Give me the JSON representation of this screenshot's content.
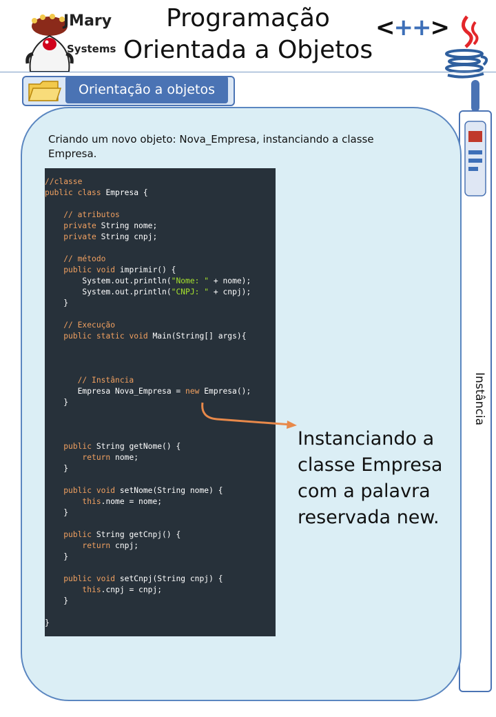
{
  "header": {
    "logo_line1": "JMary",
    "logo_line2": "Systems",
    "title_line1": "Programação",
    "title_line2": "Orientada a Objetos",
    "cpp_left": "<",
    "cpp_plus": "++",
    "cpp_right": ">"
  },
  "section": {
    "label": "Orientação a objetos"
  },
  "sidebar": {
    "label": "Instância"
  },
  "content": {
    "intro": "Criando um novo objeto: Nova_Empresa, instanciando a classe Empresa.",
    "callout": "Instanciando a classe Empresa com a palavra reservada new."
  },
  "code": [
    "//classe",
    "public class Empresa {",
    "",
    "    // atributos",
    "    private String nome;",
    "    private String cnpj;",
    "",
    "    // método",
    "    public void imprimir() {",
    "        System.out.println(\"Nome: \" + nome);",
    "        System.out.println(\"CNPJ: \" + cnpj);",
    "    }",
    "",
    "    // Execução",
    "    public static void Main(String[] args){",
    "",
    "",
    "",
    "       // Instância",
    "       Empresa Nova_Empresa = new Empresa();",
    "    }",
    "",
    "",
    "",
    "    public String getNome() {",
    "        return nome;",
    "    }",
    "",
    "    public void setNome(String nome) {",
    "        this.nome = nome;",
    "    }",
    "",
    "    public String getCnpj() {",
    "        return cnpj;",
    "    }",
    "",
    "    public void setCnpj(String cnpj) {",
    "        this.cnpj = cnpj;",
    "    }",
    "",
    "}"
  ],
  "colors": {
    "accent": "#4a73b4",
    "panel": "#dbeef5",
    "code_bg": "#27313a",
    "keyword": "#f0a060",
    "string": "#a6e22e"
  }
}
